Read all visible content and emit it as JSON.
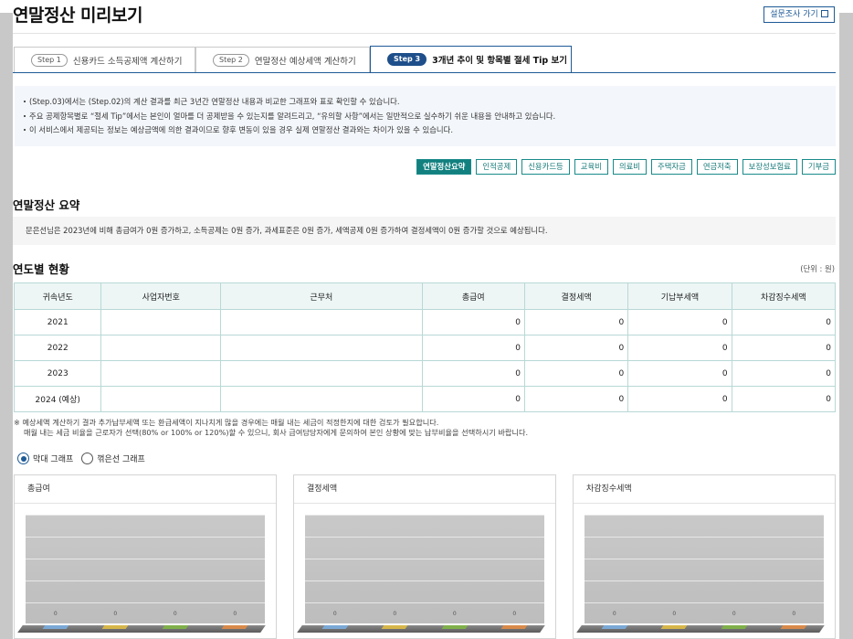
{
  "page": {
    "title": "연말정산 미리보기",
    "survey_button": "설문조사 가기"
  },
  "tabs": [
    {
      "step": "Step 1",
      "label": "신용카드 소득공제액 계산하기"
    },
    {
      "step": "Step 2",
      "label": "연말정산 예상세액 계산하기"
    },
    {
      "step": "Step 3",
      "label": "3개년 추이 및 항목별 절세 Tip 보기"
    }
  ],
  "notice": [
    "(Step.03)에서는 (Step.02)의 계산 결과를 최근 3년간 연말정산 내용과 비교한 그래프와 표로 확인할 수 있습니다.",
    "주요 공제항목별로 “절세 Tip”에서는 본인이 얼마를 더 공제받을 수 있는지를 알려드리고, “유의할 사항”에서는 일반적으로 실수하기 쉬운 내용을 안내하고 있습니다.",
    "이 서비스에서 제공되는 정보는 예상금액에 의한 결과이므로 향후 변동이 있을 경우 실제 연말정산 결과와는 차이가 있을 수 있습니다."
  ],
  "chips": [
    "연말정산요약",
    "인적공제",
    "신용카드등",
    "교육비",
    "의료비",
    "주택자금",
    "연금저축",
    "보장성보험료",
    "기부금"
  ],
  "summary": {
    "title": "연말정산 요약",
    "text": "문은선님은 2023년에 비해 총급여가 0원 증가하고, 소득공제는 0원 증가, 과세표준은 0원 증가, 세액공제 0원 증가하여 결정세액이 0원 증가할 것으로 예상됩니다."
  },
  "yearly": {
    "title": "연도별 현황",
    "unit": "(단위 : 원)",
    "columns": [
      "귀속년도",
      "사업자번호",
      "근무처",
      "총급여",
      "결정세액",
      "기납부세액",
      "차감징수세액"
    ],
    "rows": [
      {
        "year": "2021",
        "biz": "",
        "work": "",
        "gross": "0",
        "tax": "0",
        "paid": "0",
        "diff": "0"
      },
      {
        "year": "2022",
        "biz": "",
        "work": "",
        "gross": "0",
        "tax": "0",
        "paid": "0",
        "diff": "0"
      },
      {
        "year": "2023",
        "biz": "",
        "work": "",
        "gross": "0",
        "tax": "0",
        "paid": "0",
        "diff": "0"
      },
      {
        "year": "2024 (예상)",
        "biz": "",
        "work": "",
        "gross": "0",
        "tax": "0",
        "paid": "0",
        "diff": "0"
      }
    ]
  },
  "note": {
    "line1": "※ 예상세액 계산하기 결과 추가납부세액 또는 환급세액이 지나치게 많을 경우에는 매월 내는 세금이 적정한지에 대한 검토가 필요합니다.",
    "line2": "매월 내는 세금 비율을 근로자가 선택(80% or 100% or 120%)할 수 있으니, 회사 급여담당자에게 문의하여 본인 상황에 맞는 납부비율을 선택하시기 바랍니다."
  },
  "graph_options": {
    "bar": "막대 그래프",
    "line": "꺾은선 그래프",
    "selected": "bar"
  },
  "chart_data": [
    {
      "type": "bar",
      "title": "총급여",
      "categories": [
        "",
        "",
        "",
        ""
      ],
      "values": [
        0,
        0,
        0,
        0
      ],
      "colors": [
        "#7aa9d6",
        "#d6b64a",
        "#7fb04a",
        "#d98a4a"
      ]
    },
    {
      "type": "bar",
      "title": "결정세액",
      "categories": [
        "",
        "",
        "",
        ""
      ],
      "values": [
        0,
        0,
        0,
        0
      ],
      "colors": [
        "#7aa9d6",
        "#d6b64a",
        "#7fb04a",
        "#d98a4a"
      ]
    },
    {
      "type": "bar",
      "title": "차감징수세액",
      "categories": [
        "",
        "",
        "",
        ""
      ],
      "values": [
        0,
        0,
        0,
        0
      ],
      "colors": [
        "#7aa9d6",
        "#d6b64a",
        "#7fb04a",
        "#d98a4a"
      ]
    }
  ]
}
